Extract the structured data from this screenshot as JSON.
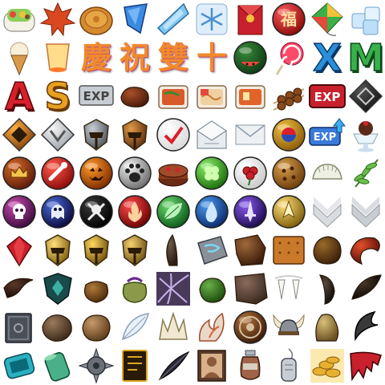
{
  "sheet": {
    "rows": [
      [
        "bento-box",
        "autumn-leaf",
        "mooncake",
        "blue-crystal",
        "sky-crystal",
        "snowflake-plate",
        "red-envelope",
        "fortune-orb",
        "kite",
        "ice-cubes"
      ],
      [
        "ice-cream-cone",
        "sky-lantern",
        "celebrate-glyph",
        "bless-glyph",
        "double-glyph",
        "ten-glyph",
        "watermelon",
        "lollipop",
        "letter-x",
        "letter-m"
      ],
      [
        "letter-a",
        "letter-s",
        "exp-tag",
        "steak-plate",
        "chili-dish",
        "noodle-tray",
        "kimchi-dish",
        "skewers",
        "exp-banner",
        "black-diamond"
      ],
      [
        "orange-diamond",
        "silver-chevron",
        "knight-helm",
        "bronze-emblem",
        "checkmark-orb",
        "open-envelope",
        "envelope",
        "korea-medal",
        "exp-up",
        "dessert-cup"
      ],
      [
        "crown-orb",
        "meat-orb",
        "pumpkin-orb",
        "paw-orb",
        "choco-cake",
        "clover-orb",
        "rose-orb",
        "cookie-orb",
        "dumpling",
        "herb-sprig"
      ],
      [
        "skull-orb",
        "ghost-orb",
        "crossbones-orb",
        "fire-orb",
        "leaf-orb",
        "water-orb",
        "sword-orb",
        "gold-orb",
        "silver-chevron-l",
        "silver-chevron-r"
      ],
      [
        "red-diamond",
        "gold-helm-1",
        "gold-helm-2",
        "gold-helm-3",
        "horn",
        "stone-tablet",
        "bark-chunk",
        "cracker",
        "seed-pod",
        "red-claw"
      ],
      [
        "dark-claw",
        "green-shield",
        "leather-pouch",
        "tied-sack",
        "bramble",
        "green-bundle",
        "hide-pelt",
        "fangs",
        "black-tooth",
        "dark-feather"
      ],
      [
        "spell-tome",
        "fur-bundle",
        "round-nut",
        "pale-feather",
        "bone-crown",
        "flame-shard",
        "round-shield",
        "viking-helm",
        "golden-fleece",
        "black-sickle"
      ],
      [
        "blue-bracer",
        "jade-scroll",
        "spike-gear",
        "gold-card",
        "black-quill",
        "portrait-card",
        "clay-jar",
        "dog-tag",
        "gold-coins",
        "dragon-wing"
      ]
    ],
    "text": {
      "celebrate": "慶",
      "bless": "祝",
      "double": "雙",
      "ten": "十",
      "fortune": "福",
      "x": "X",
      "m": "M",
      "a": "A",
      "s": "S",
      "exp": "EXP"
    },
    "colors": {
      "background": "#ffffff",
      "gold": "#d9a521",
      "red": "#c8202c",
      "blue": "#2a6ed0",
      "green": "#3aa84a",
      "purple": "#6a3db0",
      "dark": "#1f1f26",
      "silver": "#c8cdd4",
      "brown": "#8a5a2e"
    }
  }
}
